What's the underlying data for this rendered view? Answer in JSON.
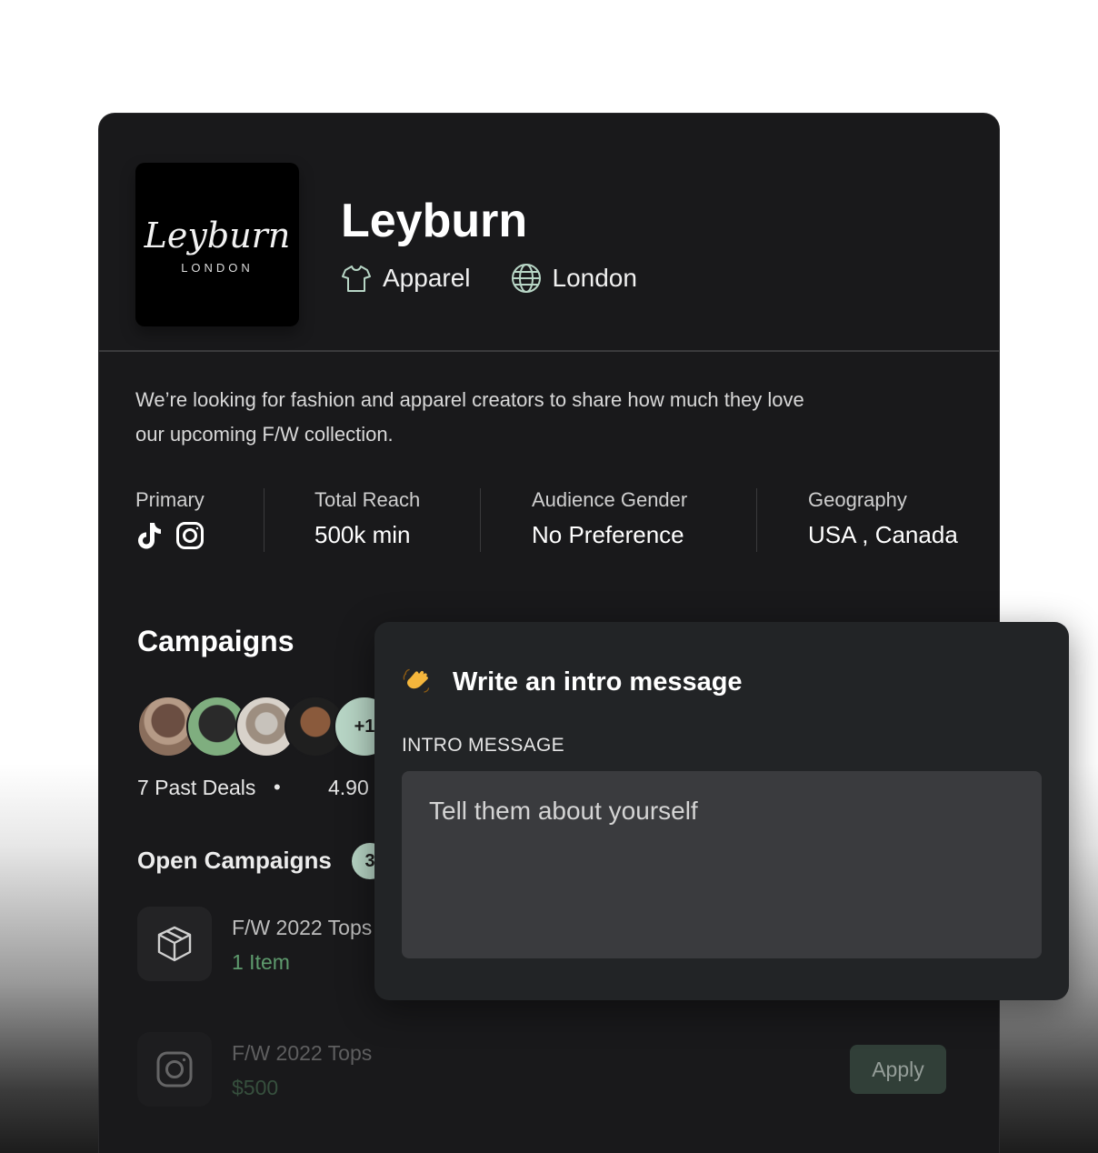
{
  "brand": {
    "logo_word": "Leyburn",
    "logo_sub": "LONDON",
    "name": "Leyburn",
    "category": "Apparel",
    "location": "London"
  },
  "description": "We’re looking for fashion and apparel creators to share how much they love our upcoming F/W collection.",
  "stats": {
    "primary_label": "Primary",
    "primary_platforms": [
      "tiktok-icon",
      "instagram-icon"
    ],
    "reach_label": "Total Reach",
    "reach_value": "500k min",
    "gender_label": "Audience Gender",
    "gender_value": "No Preference",
    "geo_label": "Geography",
    "geo_value": "USA , Canada"
  },
  "campaigns": {
    "heading": "Campaigns",
    "avatar_more": "+1",
    "past_deals": "7 Past Deals",
    "separator": "•",
    "rating": "4.90",
    "open_heading": "Open Campaigns",
    "open_count": "3",
    "items": [
      {
        "icon": "box-icon",
        "title": "F/W 2022 Tops",
        "sub": "1 Item"
      },
      {
        "icon": "instagram-icon",
        "title": "F/W 2022 Tops",
        "sub": "$500",
        "action": "Apply"
      }
    ]
  },
  "modal": {
    "emoji": "waving-hand-icon",
    "title": "Write an intro message",
    "field_label": "INTRO MESSAGE",
    "placeholder": "Tell them about yourself",
    "value": ""
  },
  "colors": {
    "card_bg": "#19191b",
    "accent_mint": "#b8d6c6",
    "green_text": "#5e9a6d",
    "modal_bg": "#222426",
    "field_bg": "#3a3b3e"
  }
}
